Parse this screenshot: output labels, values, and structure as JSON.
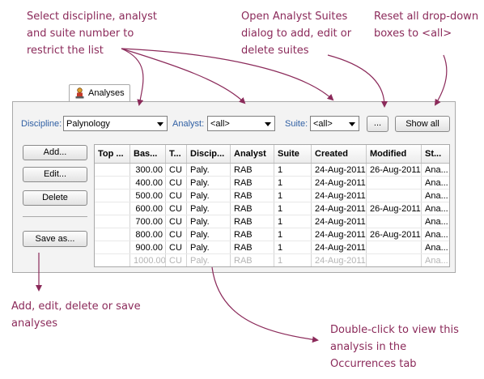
{
  "annotations": {
    "select_filter": "Select discipline, analyst\nand suite number to\nrestrict the list",
    "open_suites": "Open Analyst Suites\ndialog to add, edit or\ndelete suites",
    "reset": "Reset all drop-down\nboxes to <all>",
    "add_edit": "Add, edit, delete or save\nanalyses",
    "double_click": "Double-click to view this\nanalysis in the\nOccurrences tab"
  },
  "tab": {
    "label": "Analyses"
  },
  "filters": {
    "discipline_label": "Discipline:",
    "discipline_value": "Palynology",
    "analyst_label": "Analyst:",
    "analyst_value": "<all>",
    "suite_label": "Suite:",
    "suite_value": "<all>",
    "ellipsis_button": "...",
    "show_all_button": "Show all"
  },
  "buttons": {
    "add": "Add...",
    "edit": "Edit...",
    "delete": "Delete",
    "save_as": "Save as..."
  },
  "table": {
    "headers": [
      "Top ...",
      "Bas...",
      "T...",
      "Discip...",
      "Analyst",
      "Suite",
      "Created",
      "Modified",
      "St..."
    ],
    "rows": [
      [
        "",
        "300.00",
        "CU",
        "Paly.",
        "RAB",
        "1",
        "24-Aug-2011",
        "26-Aug-2011",
        "Ana..."
      ],
      [
        "",
        "400.00",
        "CU",
        "Paly.",
        "RAB",
        "1",
        "24-Aug-2011",
        "",
        "Ana..."
      ],
      [
        "",
        "500.00",
        "CU",
        "Paly.",
        "RAB",
        "1",
        "24-Aug-2011",
        "",
        "Ana..."
      ],
      [
        "",
        "600.00",
        "CU",
        "Paly.",
        "RAB",
        "1",
        "24-Aug-2011",
        "26-Aug-2011",
        "Ana..."
      ],
      [
        "",
        "700.00",
        "CU",
        "Paly.",
        "RAB",
        "1",
        "24-Aug-2011",
        "",
        "Ana..."
      ],
      [
        "",
        "800.00",
        "CU",
        "Paly.",
        "RAB",
        "1",
        "24-Aug-2011",
        "26-Aug-2011",
        "Ana..."
      ],
      [
        "",
        "900.00",
        "CU",
        "Paly.",
        "RAB",
        "1",
        "24-Aug-2011",
        "",
        "Ana..."
      ],
      [
        "",
        "1000.00",
        "CU",
        "Paly.",
        "RAB",
        "1",
        "24-Aug-2011",
        "",
        "Ana..."
      ]
    ]
  },
  "colors": {
    "annotation": "#8b2a5a",
    "filter_label": "#2f5fa3"
  }
}
